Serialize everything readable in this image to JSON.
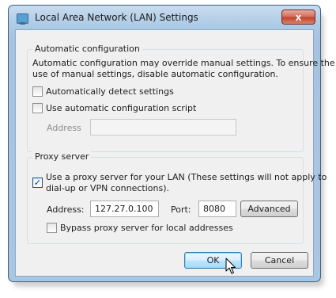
{
  "window": {
    "title": "Local Area Network (LAN) Settings",
    "close_glyph": "x"
  },
  "auto_config": {
    "legend": "Automatic configuration",
    "description_line1": "Automatic configuration may override manual settings.  To ensure the",
    "description_line2": "use of manual settings, disable automatic configuration.",
    "auto_detect_label": "Automatically detect settings",
    "auto_detect_checked": false,
    "use_script_label": "Use automatic configuration script",
    "use_script_checked": false,
    "address_label": "Address",
    "address_value": ""
  },
  "proxy": {
    "legend": "Proxy server",
    "use_proxy_line1": "Use a proxy server for your LAN (These settings will not apply to",
    "use_proxy_line2": "dial-up or VPN connections).",
    "use_proxy_checked": true,
    "address_label": "Address:",
    "address_value": "127.27.0.100",
    "port_label": "Port:",
    "port_value": "8080",
    "advanced_label": "Advanced",
    "bypass_label": "Bypass proxy server for local addresses",
    "bypass_checked": false
  },
  "buttons": {
    "ok_label": "OK",
    "cancel_label": "Cancel"
  }
}
